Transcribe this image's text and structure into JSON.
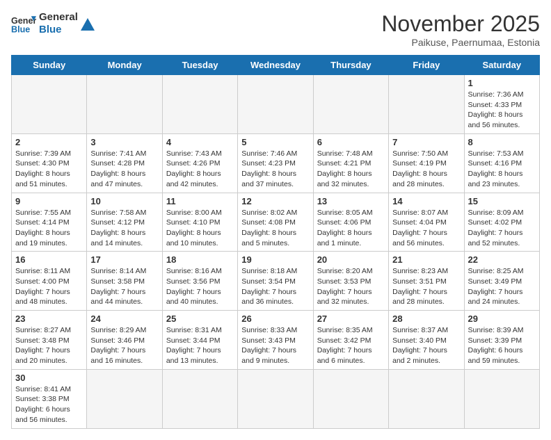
{
  "header": {
    "logo_general": "General",
    "logo_blue": "Blue",
    "month_title": "November 2025",
    "subtitle": "Paikuse, Paernumaa, Estonia"
  },
  "days_of_week": [
    "Sunday",
    "Monday",
    "Tuesday",
    "Wednesday",
    "Thursday",
    "Friday",
    "Saturday"
  ],
  "weeks": [
    [
      {
        "day": "",
        "info": ""
      },
      {
        "day": "",
        "info": ""
      },
      {
        "day": "",
        "info": ""
      },
      {
        "day": "",
        "info": ""
      },
      {
        "day": "",
        "info": ""
      },
      {
        "day": "",
        "info": ""
      },
      {
        "day": "1",
        "info": "Sunrise: 7:36 AM\nSunset: 4:33 PM\nDaylight: 8 hours and 56 minutes."
      }
    ],
    [
      {
        "day": "2",
        "info": "Sunrise: 7:39 AM\nSunset: 4:30 PM\nDaylight: 8 hours and 51 minutes."
      },
      {
        "day": "3",
        "info": "Sunrise: 7:41 AM\nSunset: 4:28 PM\nDaylight: 8 hours and 47 minutes."
      },
      {
        "day": "4",
        "info": "Sunrise: 7:43 AM\nSunset: 4:26 PM\nDaylight: 8 hours and 42 minutes."
      },
      {
        "day": "5",
        "info": "Sunrise: 7:46 AM\nSunset: 4:23 PM\nDaylight: 8 hours and 37 minutes."
      },
      {
        "day": "6",
        "info": "Sunrise: 7:48 AM\nSunset: 4:21 PM\nDaylight: 8 hours and 32 minutes."
      },
      {
        "day": "7",
        "info": "Sunrise: 7:50 AM\nSunset: 4:19 PM\nDaylight: 8 hours and 28 minutes."
      },
      {
        "day": "8",
        "info": "Sunrise: 7:53 AM\nSunset: 4:16 PM\nDaylight: 8 hours and 23 minutes."
      }
    ],
    [
      {
        "day": "9",
        "info": "Sunrise: 7:55 AM\nSunset: 4:14 PM\nDaylight: 8 hours and 19 minutes."
      },
      {
        "day": "10",
        "info": "Sunrise: 7:58 AM\nSunset: 4:12 PM\nDaylight: 8 hours and 14 minutes."
      },
      {
        "day": "11",
        "info": "Sunrise: 8:00 AM\nSunset: 4:10 PM\nDaylight: 8 hours and 10 minutes."
      },
      {
        "day": "12",
        "info": "Sunrise: 8:02 AM\nSunset: 4:08 PM\nDaylight: 8 hours and 5 minutes."
      },
      {
        "day": "13",
        "info": "Sunrise: 8:05 AM\nSunset: 4:06 PM\nDaylight: 8 hours and 1 minute."
      },
      {
        "day": "14",
        "info": "Sunrise: 8:07 AM\nSunset: 4:04 PM\nDaylight: 7 hours and 56 minutes."
      },
      {
        "day": "15",
        "info": "Sunrise: 8:09 AM\nSunset: 4:02 PM\nDaylight: 7 hours and 52 minutes."
      }
    ],
    [
      {
        "day": "16",
        "info": "Sunrise: 8:11 AM\nSunset: 4:00 PM\nDaylight: 7 hours and 48 minutes."
      },
      {
        "day": "17",
        "info": "Sunrise: 8:14 AM\nSunset: 3:58 PM\nDaylight: 7 hours and 44 minutes."
      },
      {
        "day": "18",
        "info": "Sunrise: 8:16 AM\nSunset: 3:56 PM\nDaylight: 7 hours and 40 minutes."
      },
      {
        "day": "19",
        "info": "Sunrise: 8:18 AM\nSunset: 3:54 PM\nDaylight: 7 hours and 36 minutes."
      },
      {
        "day": "20",
        "info": "Sunrise: 8:20 AM\nSunset: 3:53 PM\nDaylight: 7 hours and 32 minutes."
      },
      {
        "day": "21",
        "info": "Sunrise: 8:23 AM\nSunset: 3:51 PM\nDaylight: 7 hours and 28 minutes."
      },
      {
        "day": "22",
        "info": "Sunrise: 8:25 AM\nSunset: 3:49 PM\nDaylight: 7 hours and 24 minutes."
      }
    ],
    [
      {
        "day": "23",
        "info": "Sunrise: 8:27 AM\nSunset: 3:48 PM\nDaylight: 7 hours and 20 minutes."
      },
      {
        "day": "24",
        "info": "Sunrise: 8:29 AM\nSunset: 3:46 PM\nDaylight: 7 hours and 16 minutes."
      },
      {
        "day": "25",
        "info": "Sunrise: 8:31 AM\nSunset: 3:44 PM\nDaylight: 7 hours and 13 minutes."
      },
      {
        "day": "26",
        "info": "Sunrise: 8:33 AM\nSunset: 3:43 PM\nDaylight: 7 hours and 9 minutes."
      },
      {
        "day": "27",
        "info": "Sunrise: 8:35 AM\nSunset: 3:42 PM\nDaylight: 7 hours and 6 minutes."
      },
      {
        "day": "28",
        "info": "Sunrise: 8:37 AM\nSunset: 3:40 PM\nDaylight: 7 hours and 2 minutes."
      },
      {
        "day": "29",
        "info": "Sunrise: 8:39 AM\nSunset: 3:39 PM\nDaylight: 6 hours and 59 minutes."
      }
    ],
    [
      {
        "day": "30",
        "info": "Sunrise: 8:41 AM\nSunset: 3:38 PM\nDaylight: 6 hours and 56 minutes."
      },
      {
        "day": "",
        "info": ""
      },
      {
        "day": "",
        "info": ""
      },
      {
        "day": "",
        "info": ""
      },
      {
        "day": "",
        "info": ""
      },
      {
        "day": "",
        "info": ""
      },
      {
        "day": "",
        "info": ""
      }
    ]
  ]
}
